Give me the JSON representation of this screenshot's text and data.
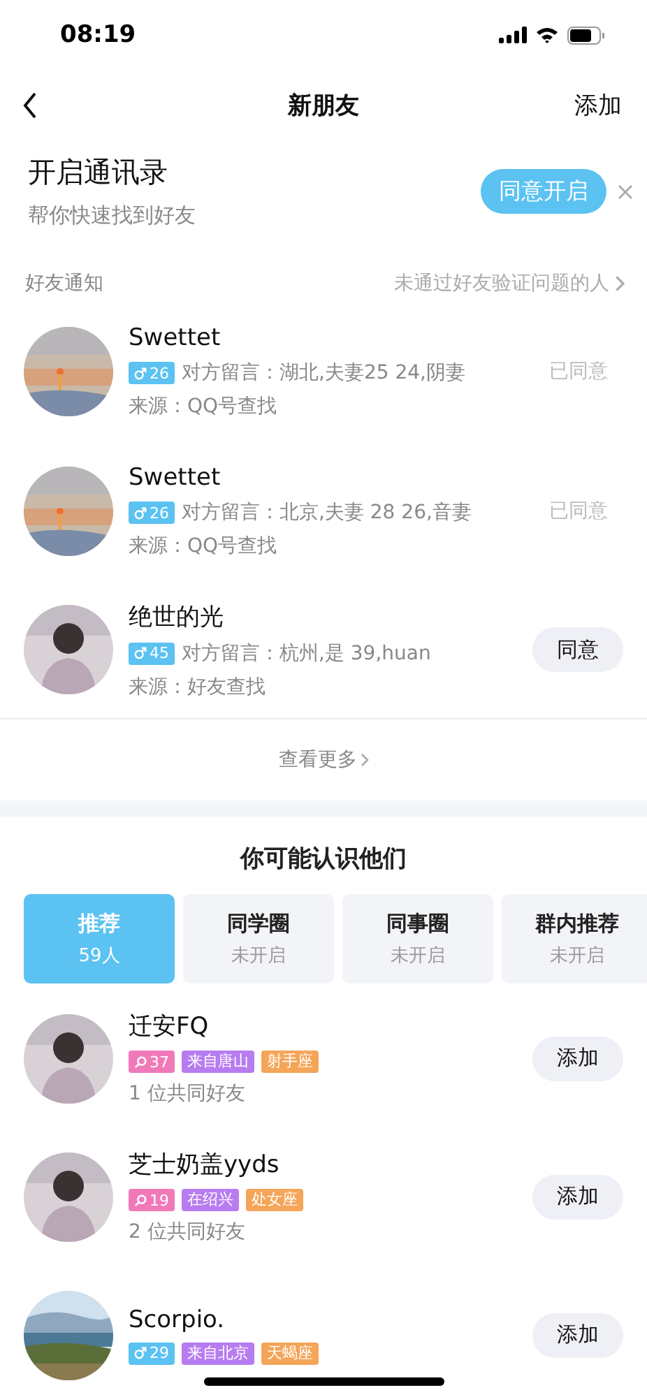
{
  "status_bar": {
    "time": "08:19"
  },
  "nav": {
    "title": "新朋友",
    "action": "添加"
  },
  "contacts_banner": {
    "title": "开启通讯录",
    "subtitle": "帮你快速找到好友",
    "button": "同意开启"
  },
  "notifications": {
    "title": "好友通知",
    "link": "未通过好友验证问题的人",
    "requests": [
      {
        "name": "Swettet",
        "female": false,
        "age": "26",
        "message": "对方留言：湖北,夫妻25  24,阴妻",
        "source": "来源：QQ号查找",
        "status": "已同意",
        "accepted": true
      },
      {
        "name": "Swettet",
        "female": false,
        "age": "26",
        "message": "对方留言：北京,夫妻  28 26,音妻",
        "source": "来源：QQ号查找",
        "status": "已同意",
        "accepted": true
      },
      {
        "name": "绝世的光",
        "female": false,
        "age": "45",
        "message": "对方留言：杭州,是 39,huan",
        "source": "来源：好友查找",
        "status": "同意",
        "accepted": false
      }
    ],
    "more": "查看更多"
  },
  "suggestions": {
    "title": "你可能认识他们",
    "tabs": [
      {
        "label": "推荐",
        "sub": "59人",
        "selected": true
      },
      {
        "label": "同学圈",
        "sub": "未开启",
        "selected": false
      },
      {
        "label": "同事圈",
        "sub": "未开启",
        "selected": false
      },
      {
        "label": "群内推荐",
        "sub": "未开启",
        "selected": false
      }
    ],
    "people": [
      {
        "name": "迁安FQ",
        "female": true,
        "age": "37",
        "tags": [
          {
            "text": "来自唐山",
            "color": "#b77cf0"
          },
          {
            "text": "射手座",
            "color": "#f4a558"
          }
        ],
        "mutual": "1 位共同好友",
        "button": "添加"
      },
      {
        "name": "芝士奶盖yyds",
        "female": true,
        "age": "19",
        "tags": [
          {
            "text": "在绍兴",
            "color": "#b77cf0"
          },
          {
            "text": "处女座",
            "color": "#f4a558"
          }
        ],
        "mutual": "2 位共同好友",
        "button": "添加"
      },
      {
        "name": "Scorpio.",
        "female": false,
        "age": "29",
        "tags": [
          {
            "text": "来自北京",
            "color": "#b77cf0"
          },
          {
            "text": "天蝎座",
            "color": "#f4a558"
          }
        ],
        "button": "添加"
      }
    ]
  }
}
